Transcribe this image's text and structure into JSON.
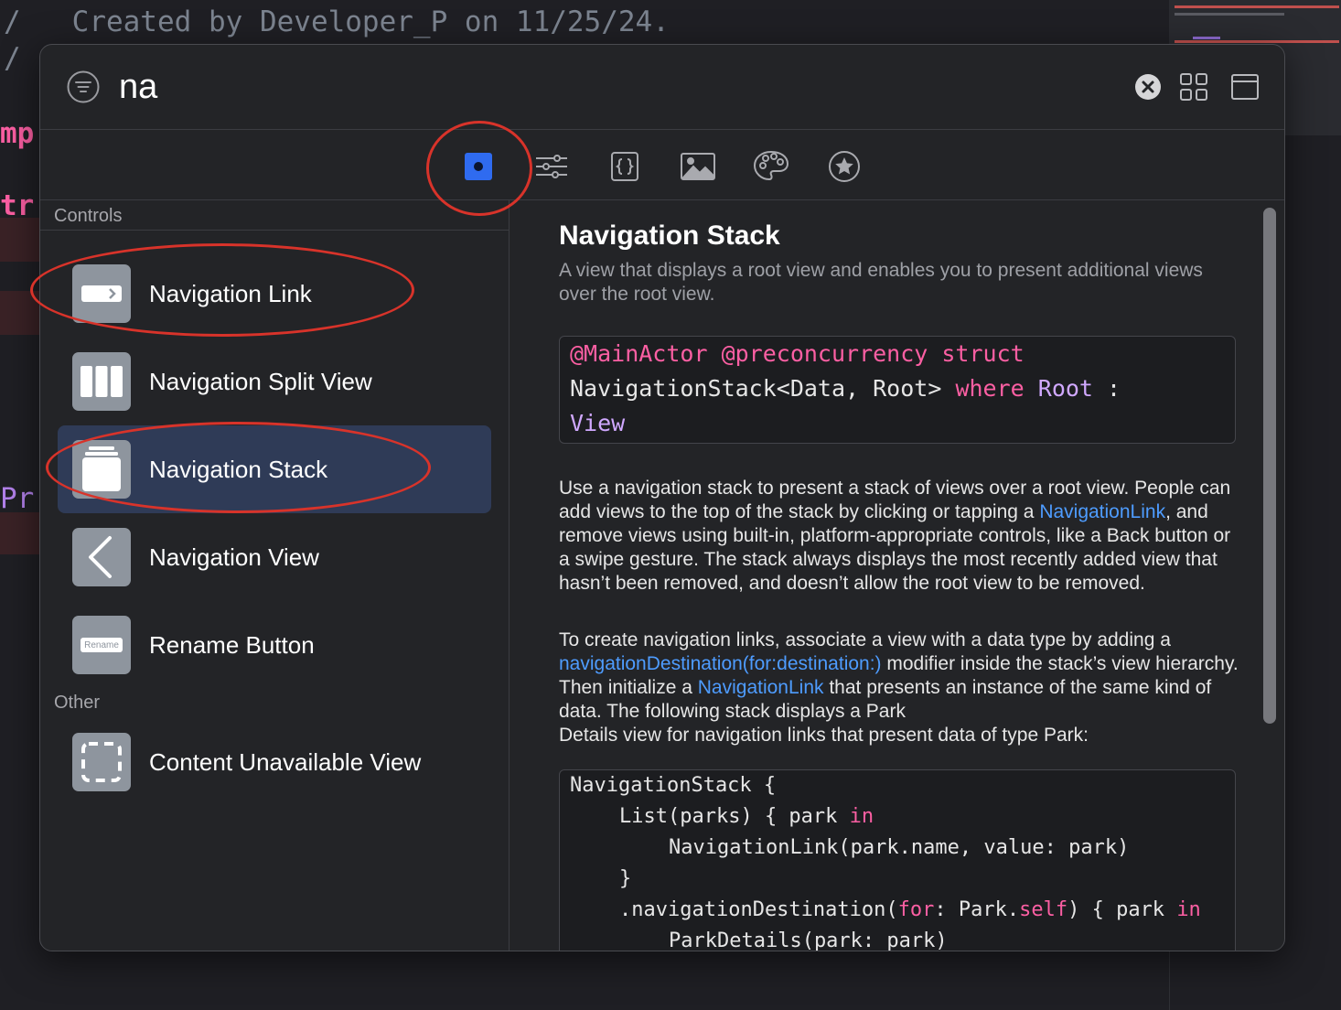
{
  "editor": {
    "comment_lines": [
      "/   Created by Developer_P on 11/25/24.",
      "/"
    ],
    "fragments": [
      "mp",
      "tr",
      "Pr"
    ]
  },
  "search": {
    "value": "na",
    "placeholder": ""
  },
  "tabs": [
    {
      "name": "views",
      "selected": true
    },
    {
      "name": "modifiers",
      "selected": false
    },
    {
      "name": "snippets",
      "selected": false
    },
    {
      "name": "media",
      "selected": false
    },
    {
      "name": "colors",
      "selected": false
    },
    {
      "name": "symbols",
      "selected": false
    }
  ],
  "sections": {
    "controls": "Controls",
    "other": "Other"
  },
  "items": [
    {
      "label": "Navigation Link",
      "icon": "navigation-link-icon"
    },
    {
      "label": "Navigation Split View",
      "icon": "split-view-icon"
    },
    {
      "label": "Navigation Stack",
      "icon": "stack-icon",
      "selected": true
    },
    {
      "label": "Navigation View",
      "icon": "chevron-left-icon"
    },
    {
      "label": "Rename Button",
      "icon": "rename-button-icon",
      "thumb_text": "Rename"
    },
    {
      "label": "Content Unavailable View",
      "icon": "content-unavailable-icon"
    }
  ],
  "detail": {
    "title": "Navigation Stack",
    "abstract": "A view that displays a root view and enables you to present additional views over the root view.",
    "declaration": {
      "line1": [
        "@MainActor @preconcurrency struct"
      ],
      "line2": [
        "NavigationStack<Data, Root> ",
        "where",
        " ",
        "Root",
        " :"
      ],
      "line3": [
        "View"
      ]
    },
    "para1": [
      "Use a navigation stack to present a stack of views over a root view. People can add views to the top of the stack by clicking or tapping a ",
      "NavigationLink",
      ", and remove views using built-in, platform-appropriate controls, like a Back button or a swipe gesture. The stack always displays the most recently added view that hasn’t been removed, and doesn’t allow the root view to be removed."
    ],
    "para2": [
      "To create navigation links, associate a view with a data type by adding a ",
      "navigationDestination(for:destination:)",
      " modifier inside the stack’s view hierarchy. Then initialize a ",
      "NavigationLink",
      " that presents an instance of the same kind of data. The following stack displays a Park",
      "Details view for navigation links that present data of type Park:"
    ],
    "sample": {
      "l1": "NavigationStack {",
      "l2a": "List(parks) { park ",
      "l2b": "in",
      "l3": "NavigationLink(park.name, value: park)",
      "l4": "}",
      "l5a": ".navigationDestination(",
      "l5b": "for",
      "l5c": ": Park.",
      "l5d": "self",
      "l5e": ") { park ",
      "l5f": "in",
      "l6": "ParkDetails(park: park)"
    }
  },
  "colors": {
    "accent": "#2f6bf0",
    "annotation": "#d8332a",
    "link": "#4e9cff",
    "keyword": "#fc5fa3"
  }
}
